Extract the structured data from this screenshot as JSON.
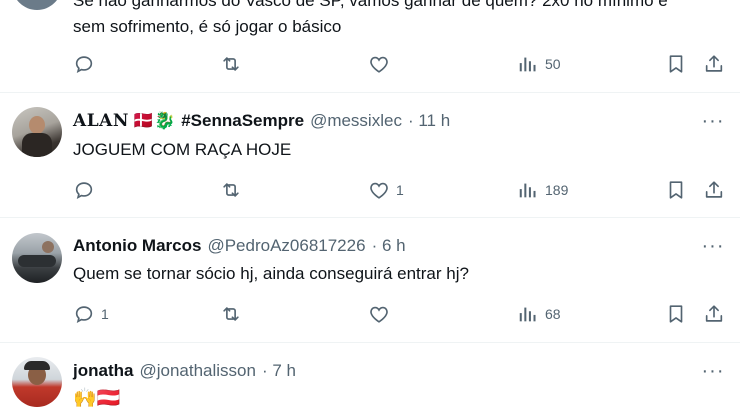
{
  "posts": [
    {
      "text_line1": "Se não ganharmos do Vasco de SP, vamos ganhar de quem? 2x0 no mínimo e",
      "text_line2": "sem sofrimento, é só jogar o básico",
      "replies": "",
      "reposts": "",
      "likes": "",
      "views": "50"
    },
    {
      "name": "ALAN",
      "name_emoji": "🇩🇰🐉",
      "hashtag": "#SennaSempre",
      "handle": "@messixlec",
      "time": "· 11 h",
      "text": "JOGUEM COM RAÇA HOJE",
      "replies": "",
      "reposts": "",
      "likes": "1",
      "views": "189"
    },
    {
      "name": "Antonio Marcos",
      "handle": "@PedroAz06817226",
      "time": "· 6 h",
      "text": "Quem se tornar sócio hj, ainda conseguirá entrar hj?",
      "replies": "1",
      "reposts": "",
      "likes": "",
      "views": "68"
    },
    {
      "name": "jonatha",
      "handle": "@jonathalisson",
      "time": "· 7 h",
      "text": "🙌🇦🇹"
    }
  ],
  "more_label": "···",
  "icons": [
    "reply-icon",
    "repost-icon",
    "like-icon",
    "views-icon",
    "bookmark-icon",
    "share-icon",
    "more-icon"
  ],
  "colors": {
    "text": "#0f1419",
    "secondary": "#536471",
    "divider": "#eff3f4"
  }
}
